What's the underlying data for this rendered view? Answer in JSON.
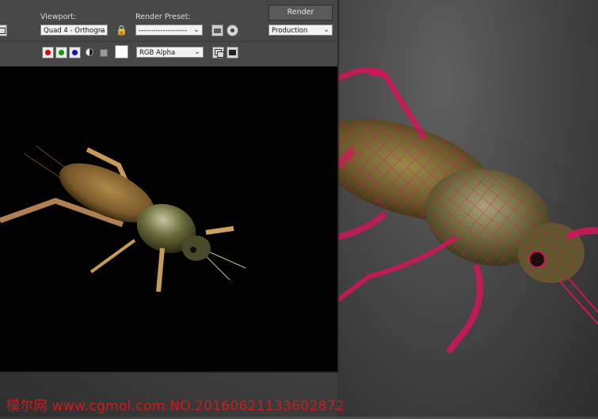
{
  "toolbar": {
    "viewport_label": "Viewport:",
    "viewport_value": "Quad 4 - Orthogra",
    "render_preset_label": "Render Preset:",
    "render_preset_value": "--------------------",
    "render_button": "Render",
    "production_value": "Production",
    "channel_value": "RGB Alpha"
  },
  "icons": {
    "left_icon": "window-icon",
    "lock": "lock-icon",
    "preset_load": "folder-open-icon",
    "preset_settings": "gear-icon",
    "red": "red-channel-icon",
    "green": "green-channel-icon",
    "blue": "blue-channel-icon",
    "alpha": "alpha-toggle-icon",
    "mono": "mono-icon",
    "swatch": "color-swatch-icon",
    "clone": "clone-window-icon",
    "display": "display-toggle-icon"
  },
  "colors": {
    "red_dot": "#e00000",
    "green_dot": "#0a9a0a",
    "blue_dot": "#1010c8",
    "wire": "#d4145a",
    "watermark": "#d21a1a"
  },
  "watermark": "模尔网 www.cgmol.com NO.20160621133602872"
}
